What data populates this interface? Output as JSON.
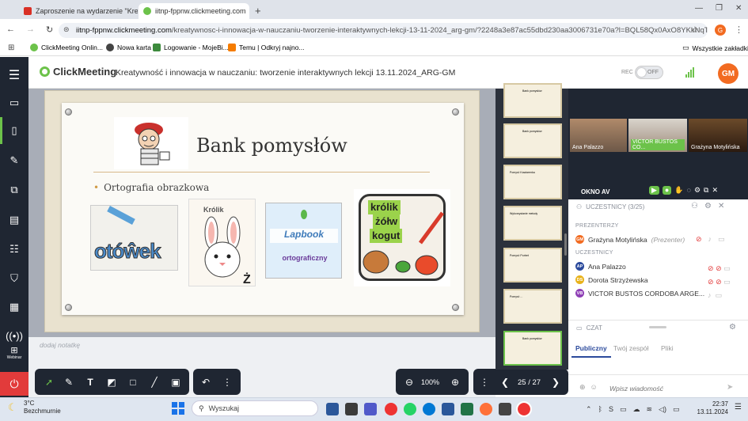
{
  "browser": {
    "tabs": [
      {
        "title": "Zaproszenie na wydarzenie \"Kre"
      },
      {
        "title": "iitnp-fppnw.clickmeeting.com"
      }
    ],
    "url_host": "iitnp-fppnw.clickmeeting.com",
    "url_path": "/kreatywnosc-i-innowacja-w-nauczaniu-tworzenie-interaktywnych-lekcji-13-11-2024_arg-gm/?2248a3e87ac55dbd230aa3006731e70a?l=BQL58Qx0AxO8YKkNqTlholkuov56...",
    "profile_initial": "G",
    "bookmarks": [
      "ClickMeeting Onlin...",
      "Nowa karta",
      "Logowanie - MojeBi...",
      "Temu | Odkryj najno..."
    ],
    "all_bookmarks": "Wszystkie zakładki"
  },
  "app": {
    "logo": "ClickMeeting",
    "meeting_title": "Kreatywność i innowacja w nauczaniu: tworzenie interaktywnych lekcji 13.11.2024_ARG-GM",
    "rec_label": "REC",
    "rec_toggle": "OFF",
    "user_initials": "GM",
    "webinar_label": "Webinar"
  },
  "slide": {
    "title": "Bank pomysłów",
    "bullet": "Ortografia obrazkowa",
    "img1_text": "otóŵek",
    "img2_text": "Królik",
    "img3_text": "Lapbook",
    "img3_sub": "ortograficzny",
    "img4_words": [
      "królik",
      "żółw",
      "kogut"
    ]
  },
  "notes_placeholder": "dodaj notatkę",
  "toolbar": {
    "zoom": "100%",
    "page": "25 / 27"
  },
  "thumbnails": [
    {
      "title": "Bank pomysłów"
    },
    {
      "title": "Bank pomysłów"
    },
    {
      "title": "Pomysł: Kawiarenka"
    },
    {
      "title": "Wykorzystanie metody"
    },
    {
      "title": "Pomysł: Portret"
    },
    {
      "title": "Pomysł: ..."
    },
    {
      "title": "Bank pomysłów"
    }
  ],
  "videos": [
    {
      "name": "Ana Palazzo"
    },
    {
      "name": "VICTOR BUSTOS CO..."
    },
    {
      "name": "Grażyna Motylińska"
    }
  ],
  "okno_label": "OKNO AV",
  "participants": {
    "header": "UCZESTNICY (3/25)",
    "presenters_label": "PREZENTERZY",
    "presenter": {
      "initials": "GM",
      "name": "Grażyna Motylińska",
      "role": "(Prezenter)"
    },
    "attendees_label": "UCZESTNICY",
    "attendees": [
      {
        "initials": "AP",
        "name": "Ana Palazzo",
        "color": "#2b4a9c"
      },
      {
        "initials": "DS",
        "name": "Dorota Strzyżewska",
        "color": "#e8b21a"
      },
      {
        "initials": "VB",
        "name": "VICTOR BUSTOS CORDOBA ARGE...",
        "color": "#8e3fb5"
      }
    ]
  },
  "chat": {
    "header": "CZAT",
    "tabs": [
      "Publiczny",
      "Twój zespół",
      "Pliki"
    ],
    "placeholder": "Wpisz wiadomość"
  },
  "taskbar": {
    "temperature": "3°C",
    "weather": "Bezchmurnie",
    "search": "Wyszukaj",
    "time": "22:37",
    "date": "13.11.2024"
  },
  "colors": {
    "accent": "#6cc24a",
    "dark": "#1f2632",
    "avatar_orange": "#f26b21"
  }
}
